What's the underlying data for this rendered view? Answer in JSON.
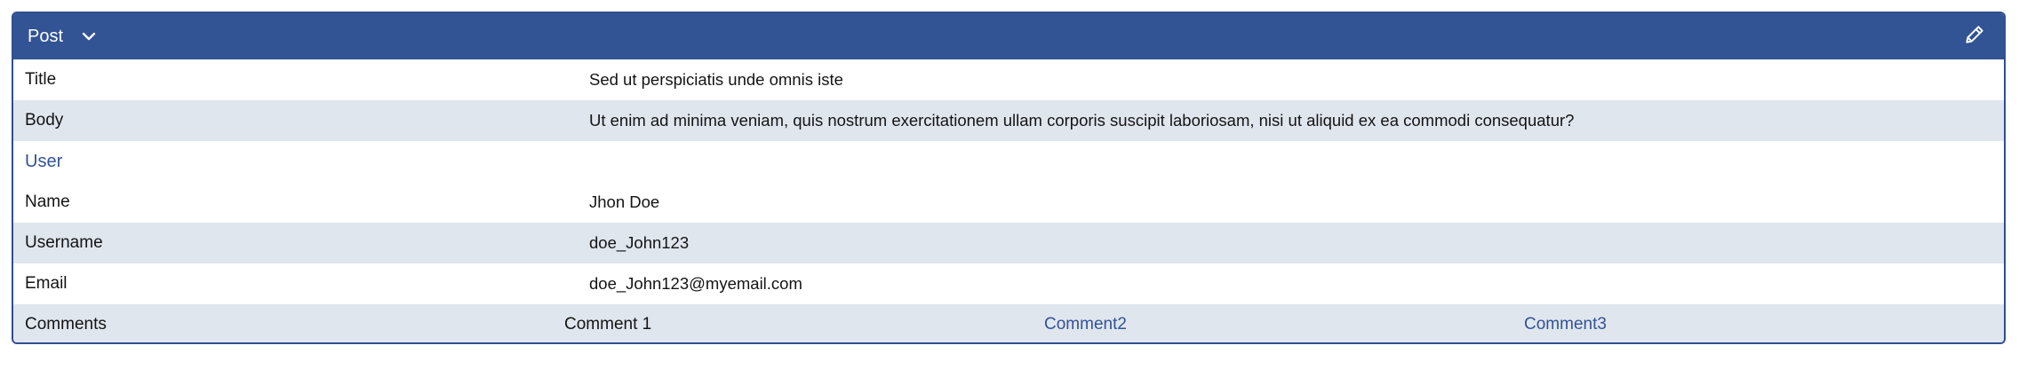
{
  "header": {
    "title": "Post",
    "expand_icon": "chevron-down-icon",
    "edit_icon": "pencil-icon"
  },
  "fields": {
    "title": {
      "label": "Title",
      "value": "Sed ut perspiciatis unde omnis iste"
    },
    "body": {
      "label": "Body",
      "value": "Ut enim ad minima veniam, quis nostrum exercitationem ullam corporis suscipit laboriosam, nisi ut aliquid ex ea commodi consequatur?"
    }
  },
  "user": {
    "section_label": "User",
    "name": {
      "label": "Name",
      "value": "Jhon Doe"
    },
    "username": {
      "label": "Username",
      "value": "doe_John123"
    },
    "email": {
      "label": "Email",
      "value": "doe_John123@myemail.com"
    }
  },
  "comments": {
    "label": "Comments",
    "items": [
      "Comment 1",
      "Comment2",
      "Comment3"
    ]
  },
  "colors": {
    "header_bg": "#325394",
    "alt_row_bg": "#e0e6ee",
    "link": "#325394"
  }
}
